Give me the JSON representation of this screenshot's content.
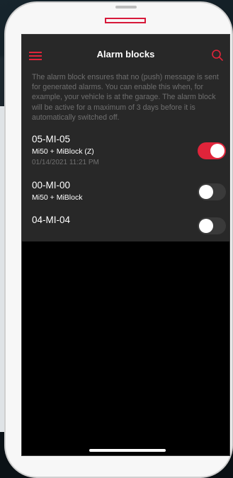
{
  "app": {
    "title": "Alarm blocks"
  },
  "colors": {
    "accent": "#e0243a",
    "background": "#282828",
    "text": "#ffffff",
    "muted_text": "#6f6f6f"
  },
  "icons": {
    "menu": "hamburger-menu-icon",
    "search": "search-icon"
  },
  "description": "The alarm block ensures that no (push) message is sent for generated alarms. You can enable this when, for example, your vehicle is at the garage. The alarm block will be active for a maximum of 3 days before it is automatically switched off.",
  "vehicles": [
    {
      "plate": "05-MI-05",
      "model": "Mi50 + MiBlock (Z)",
      "date": "01/14/2021 11:21 PM",
      "enabled": true
    },
    {
      "plate": "00-MI-00",
      "model": "Mi50 + MiBlock",
      "date": "",
      "enabled": false
    },
    {
      "plate": "04-MI-04",
      "model": "",
      "date": "",
      "enabled": false
    }
  ]
}
